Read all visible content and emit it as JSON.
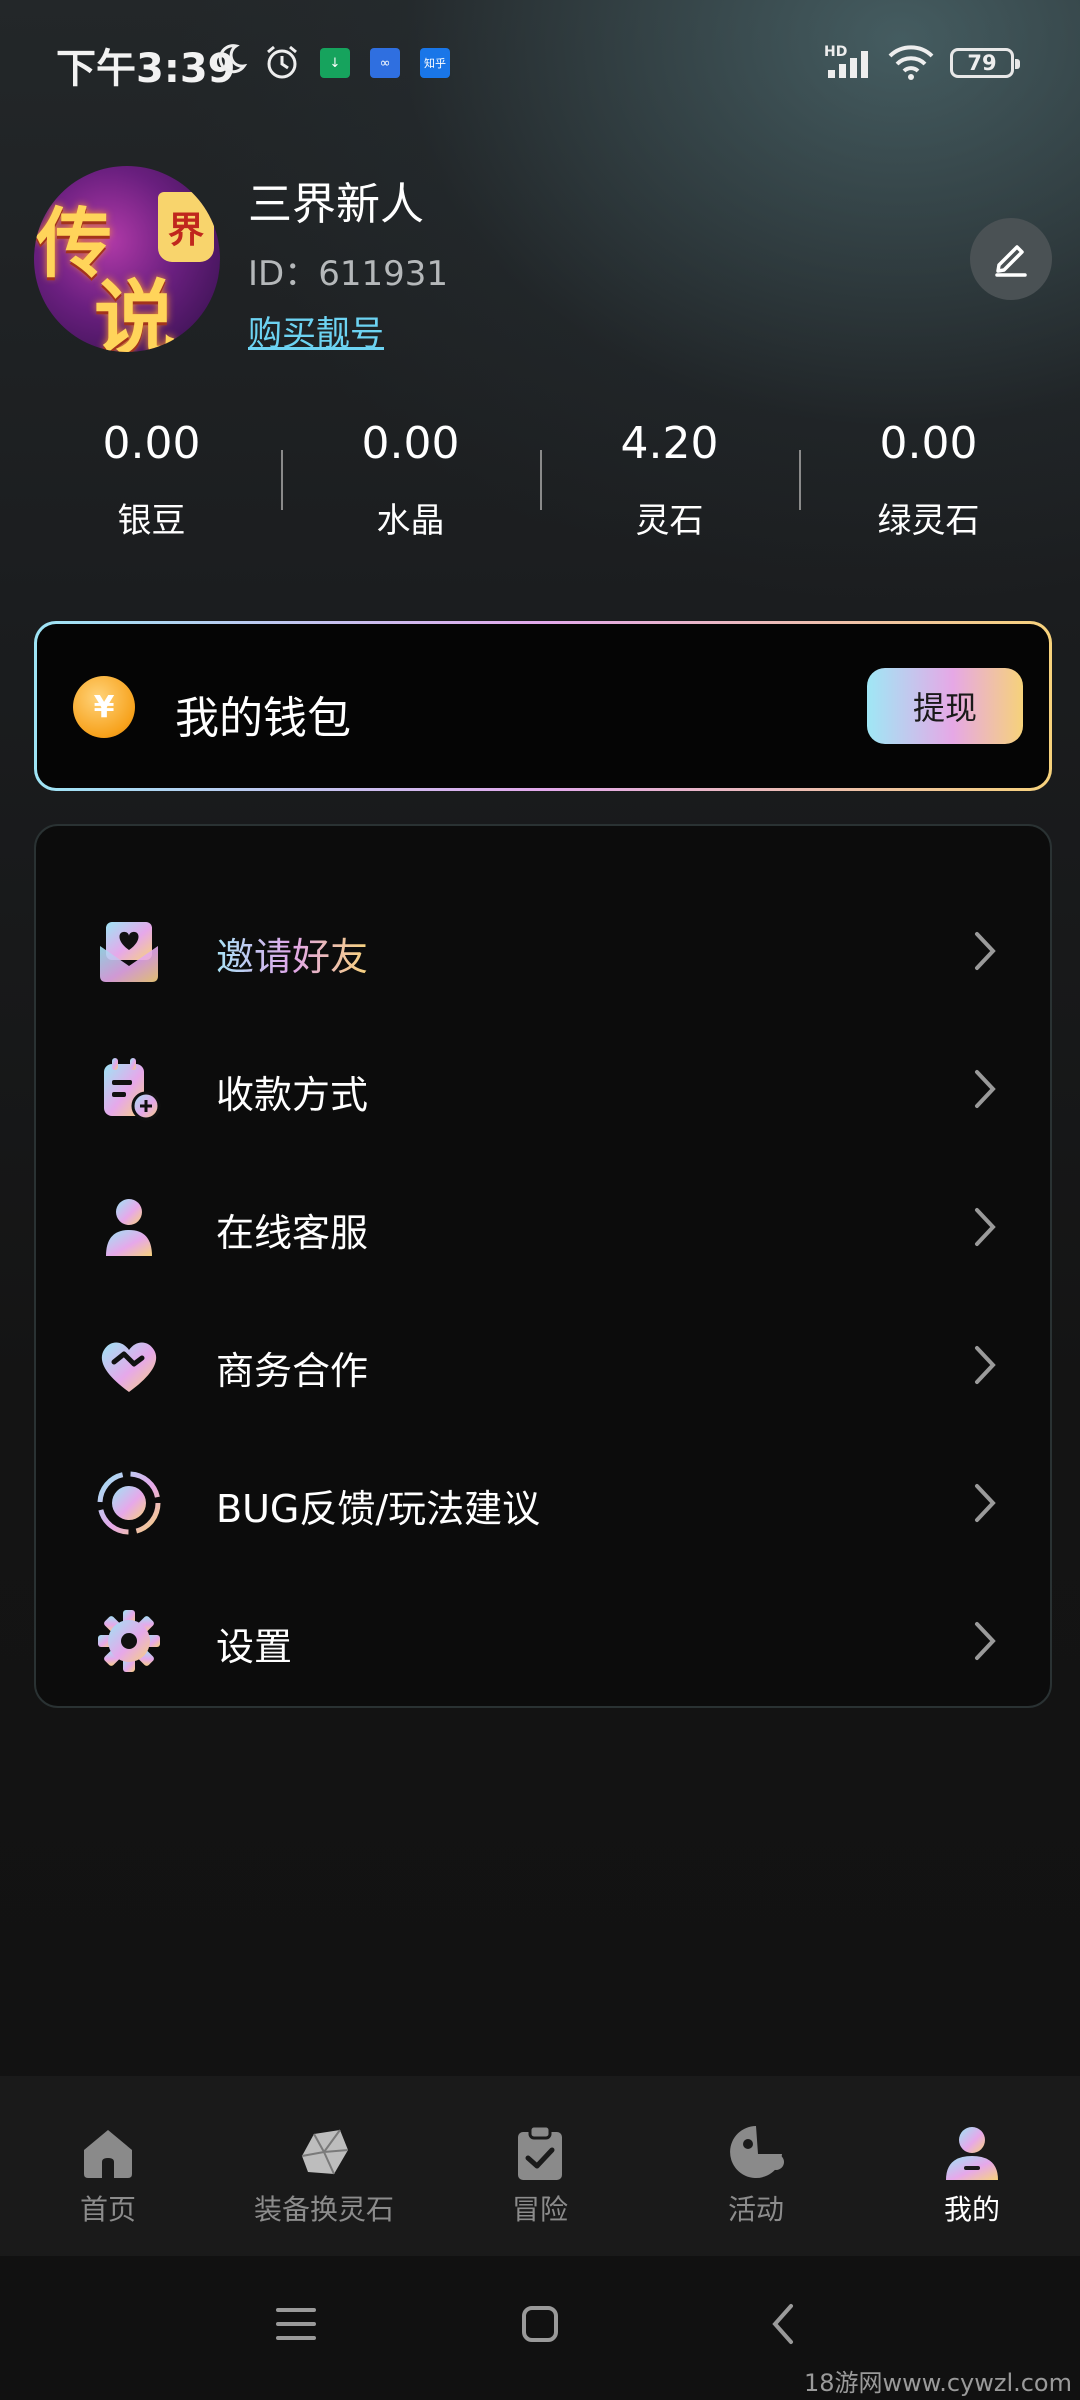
{
  "status_bar": {
    "time": "下午3:39",
    "app_badges": [
      "↓",
      "∞",
      "知乎"
    ],
    "network": "HD",
    "battery": "79"
  },
  "profile": {
    "nickname": "三界新人",
    "id_text": "ID：611931",
    "buy_link": "购买靓号",
    "avatar_glyphs": [
      "传",
      "说",
      "界"
    ]
  },
  "stats": [
    {
      "value": "0.00",
      "label": "银豆"
    },
    {
      "value": "0.00",
      "label": "水晶"
    },
    {
      "value": "4.20",
      "label": "灵石"
    },
    {
      "value": "0.00",
      "label": "绿灵石"
    }
  ],
  "wallet": {
    "title": "我的钱包",
    "withdraw_label": "提现",
    "coin_symbol": "¥"
  },
  "menu": [
    {
      "label": "邀请好友",
      "icon": "invite-mail-icon"
    },
    {
      "label": "收款方式",
      "icon": "payment-method-icon"
    },
    {
      "label": "在线客服",
      "icon": "customer-service-icon"
    },
    {
      "label": "商务合作",
      "icon": "handshake-heart-icon"
    },
    {
      "label": "BUG反馈/玩法建议",
      "icon": "feedback-icon"
    },
    {
      "label": "设置",
      "icon": "gear-icon"
    }
  ],
  "bottom_nav": [
    {
      "label": "首页",
      "icon": "home-icon"
    },
    {
      "label": "装备换灵石",
      "icon": "gem-icon"
    },
    {
      "label": "冒险",
      "icon": "clipboard-check-icon"
    },
    {
      "label": "活动",
      "icon": "activity-icon"
    },
    {
      "label": "我的",
      "icon": "user-icon",
      "active": true
    }
  ],
  "watermark": "18游网www.cywzl.com",
  "colors": {
    "accent_gradient": [
      "#9ee4f5",
      "#e3a9ec",
      "#f7d27c"
    ],
    "link": "#6dd3f2"
  }
}
